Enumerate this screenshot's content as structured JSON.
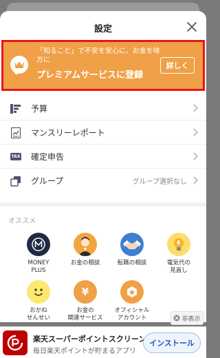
{
  "header": {
    "title": "設定"
  },
  "premium": {
    "subtext": "「知ること」で不安を安心に、お金を味方に",
    "headline": "プレミアムサービスに登録",
    "detail_label": "詳しく"
  },
  "menu": [
    {
      "label": "予算",
      "value": ""
    },
    {
      "label": "マンスリーレポート",
      "value": ""
    },
    {
      "label": "確定申告",
      "value": "",
      "icon_text": "TAX"
    },
    {
      "label": "グループ",
      "value": "グループ選択なし"
    }
  ],
  "recommend": {
    "section_label": "オススメ",
    "items": [
      {
        "label": "MONEY\nPLUS",
        "icon": "money-plus-icon"
      },
      {
        "label": "お金の相談",
        "icon": "advisor-icon"
      },
      {
        "label": "転職の相談",
        "icon": "handshake-icon"
      },
      {
        "label": "電気代の\n見直し",
        "icon": "lightbulb-icon"
      },
      {
        "label": "おかね\nせんせい",
        "icon": "smile-icon"
      },
      {
        "label": "お金の\n関連サービス",
        "icon": "yen-icon"
      },
      {
        "label": "オフィシャル\nアカウント",
        "icon": "official-icon"
      }
    ]
  },
  "ad": {
    "title": "楽天スーパーポイントスクリーン",
    "subtitle": "毎日楽天ポイントが貯まるアプリ",
    "install_label": "インストール",
    "hide_label": "非表示"
  },
  "colors": {
    "premium_bg": "#f0a046",
    "highlight_border": "#e8141a",
    "rakuten_red": "#bf0000",
    "install_text": "#1a56b8"
  }
}
